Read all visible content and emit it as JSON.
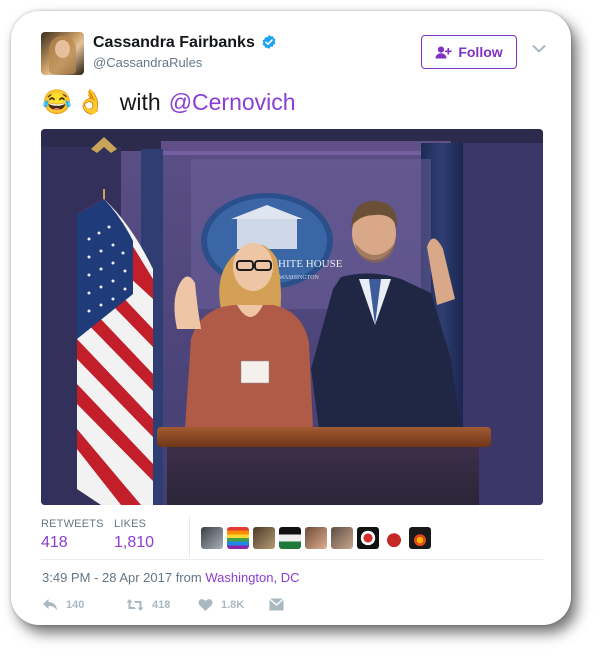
{
  "author": {
    "display_name": "Cassandra Fairbanks",
    "handle": "@CassandraRules"
  },
  "follow_label": "Follow",
  "tweet": {
    "emoji_1": "😂",
    "emoji_2": "👌",
    "text": "with",
    "mention": "@Cernovich"
  },
  "photo": {
    "sign_text": "HITE HOUSE",
    "sign_subtext": "WASHINGTON"
  },
  "stats": {
    "retweets_label": "RETWEETS",
    "retweets_value": "418",
    "likes_label": "LIKES",
    "likes_value": "1,810"
  },
  "timestamp": {
    "text": "3:49 PM - 28 Apr 2017 from",
    "place": "Washington, DC"
  },
  "actions": {
    "reply_count": "140",
    "retweet_count": "418",
    "like_count": "1.8K"
  },
  "icons": [
    "verified-icon",
    "follow-person-icon",
    "chevron-down-icon",
    "reply-icon",
    "retweet-icon",
    "heart-icon",
    "message-icon"
  ],
  "colors": {
    "accent": "#8a3ed6",
    "follow_border": "#7e31c4",
    "muted": "#657786",
    "verified": "#1da1f2",
    "action_gray": "#aab8c2"
  }
}
